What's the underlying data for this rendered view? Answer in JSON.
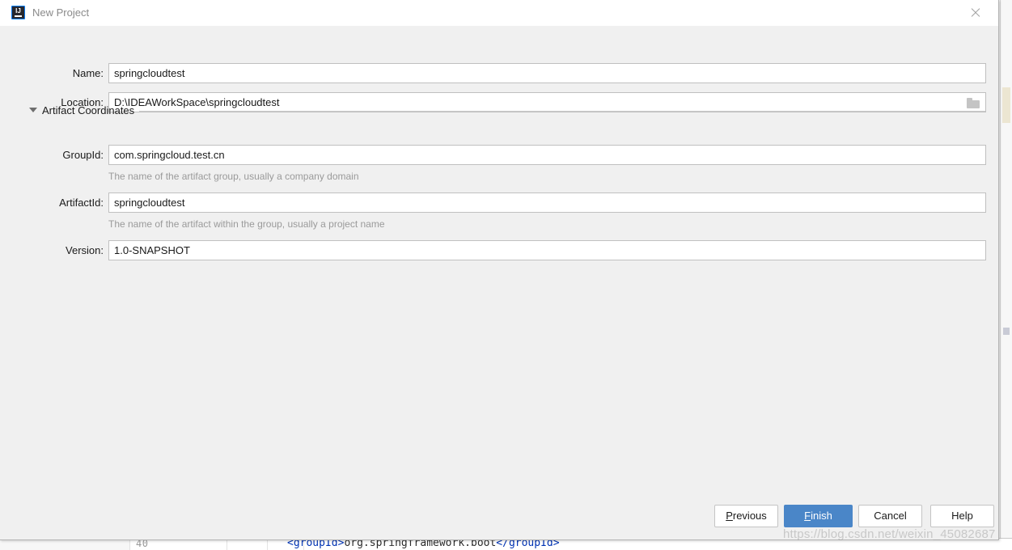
{
  "window": {
    "title": "New Project",
    "icon": "intellij-idea-icon",
    "close_label": "×"
  },
  "form": {
    "fields": [
      {
        "label": "Name:",
        "value": "springcloudtest",
        "name": "name"
      },
      {
        "label": "Location:",
        "value": "D:\\IDEAWorkSpace\\springcloudtest",
        "name": "location",
        "browse_icon": "folder-icon"
      }
    ]
  },
  "artifact_section": {
    "title": "Artifact Coordinates",
    "expanded": true,
    "toggle_icon": "triangle-down-icon",
    "fields": [
      {
        "label": "GroupId:",
        "value": "com.springcloud.test.cn",
        "hint": "The name of the artifact group, usually a company domain"
      },
      {
        "label": "ArtifactId:",
        "value": "springcloudtest",
        "hint": "The name of the artifact within the group, usually a project name"
      },
      {
        "label": "Version:",
        "value": "1.0-SNAPSHOT",
        "hint": ""
      }
    ]
  },
  "footer": {
    "buttons": [
      {
        "label": "Previous",
        "mnemonic": "P",
        "primary": false,
        "name": "previous"
      },
      {
        "label": "Finish",
        "mnemonic": "F",
        "primary": true,
        "name": "finish"
      },
      {
        "label": "Cancel",
        "mnemonic": "",
        "primary": false,
        "name": "cancel"
      },
      {
        "label": "Help",
        "mnemonic": "",
        "primary": false,
        "name": "help"
      }
    ]
  },
  "background_editor": {
    "line_number": "40",
    "code_open_tag": "<groupId>",
    "code_text": "org.springframework.boot",
    "code_close_tag": "</groupId>"
  },
  "watermark": {
    "text": "https://blog.csdn.net/weixin_45082687"
  },
  "colors": {
    "dialog_background": "#f0f0f0",
    "titlebar_background": "#ffffff",
    "primary_button": "#4a86c8",
    "hint_text": "#9a9a9a",
    "label_text": "#1a1a1a",
    "input_border": "#c0c0c0",
    "title_text": "#8a8a8a"
  }
}
